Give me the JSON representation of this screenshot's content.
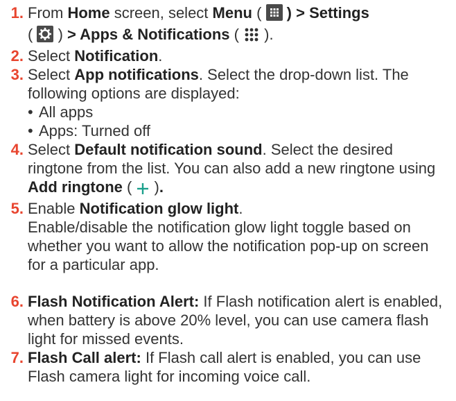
{
  "steps": [
    {
      "num": "1.",
      "t1": "From ",
      "b1": "Home",
      "t2": " screen, select ",
      "b2": "Menu",
      "t3": " ( ",
      "icon1": "apps-grid-icon",
      "t4": " ",
      "b3": ") > Settings",
      "t5": "( ",
      "icon2": "gear-icon",
      "t6": " ) ",
      "b4": "> Apps & Notifications",
      "t7": " ( ",
      "icon3": "nine-dots-icon",
      "t8": " )."
    },
    {
      "num": "2.",
      "t1": "Select ",
      "b1": "Notification",
      "t2": "."
    },
    {
      "num": "3.",
      "t1": "Select ",
      "b1": "App notifications",
      "t2": ". Select the drop-down list. The following options are displayed:",
      "bullets": [
        "All apps",
        "Apps: Turned off"
      ]
    },
    {
      "num": "4.",
      "t1": "Select ",
      "b1": "Default notification sound",
      "t2": ". Select the desired ringtone from the list. You can also add a new ringtone using ",
      "b2": "Add ringtone",
      "t3": " ( ",
      "icon1": "plus-icon",
      "t4": " )",
      "b3": "."
    },
    {
      "num": "5.",
      "t1": "Enable ",
      "b1": "Notification glow light",
      "t2": ".",
      "t3": "Enable/disable the notification glow light toggle based on whether you want to allow the notification pop-up on screen for a particular app."
    },
    {
      "num": "6.",
      "b1": "Flash Notification Alert:",
      "t1": " If Flash notification alert is enabled, when battery is above 20% level, you can use camera flash light for missed events."
    },
    {
      "num": "7.",
      "b1": "Flash Call alert:",
      "t1": " If Flash call alert is enabled, you can use Flash camera light for incoming voice call."
    }
  ],
  "colors": {
    "number": "#e8452f",
    "text": "#333333",
    "icon_dark": "#4a4a4a",
    "plus": "#1aa08c"
  }
}
